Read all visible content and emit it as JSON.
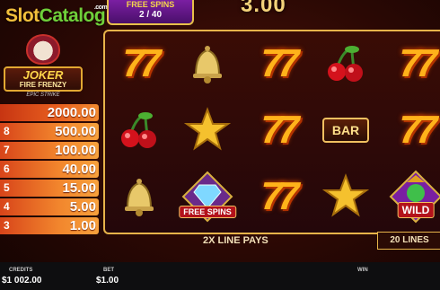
{
  "watermark": {
    "part1": "Slot",
    "part2": "Catalog",
    "suffix": ".com"
  },
  "free_spins": {
    "title": "FREE SPINS",
    "count": "2 / 40"
  },
  "top_win": "3.00",
  "game_title": {
    "line1": "JOKER",
    "line2": "FIRE FRENZY",
    "tag": "EPIC STRIKE"
  },
  "paytable": [
    {
      "count": "",
      "value": "2000.00"
    },
    {
      "count": "8",
      "value": "500.00"
    },
    {
      "count": "7",
      "value": "100.00"
    },
    {
      "count": "6",
      "value": "40.00"
    },
    {
      "count": "5",
      "value": "15.00"
    },
    {
      "count": "4",
      "value": "5.00"
    },
    {
      "count": "3",
      "value": "1.00"
    }
  ],
  "reels": [
    [
      "seven",
      "cherry",
      "bell"
    ],
    [
      "bell",
      "star",
      "diamond"
    ],
    [
      "seven",
      "seven",
      "seven"
    ],
    [
      "cherry",
      "bar",
      "star"
    ],
    [
      "seven",
      "seven",
      "wild"
    ]
  ],
  "symbol_text": {
    "bar": "BAR",
    "free_spins": "FREE SPINS",
    "wild": "WILD"
  },
  "line_pays": "2X LINE PAYS",
  "lines": "20 LINES",
  "bottom": {
    "credits_label": "CREDITS",
    "credits_value": "$1 002.00",
    "bet_label": "BET",
    "bet_value": "$1.00",
    "win_label": "WIN",
    "win_value": ""
  },
  "colors": {
    "gold": "#e7b44a",
    "fire_orange": "#f2862d",
    "panel": "#3a0c05"
  }
}
